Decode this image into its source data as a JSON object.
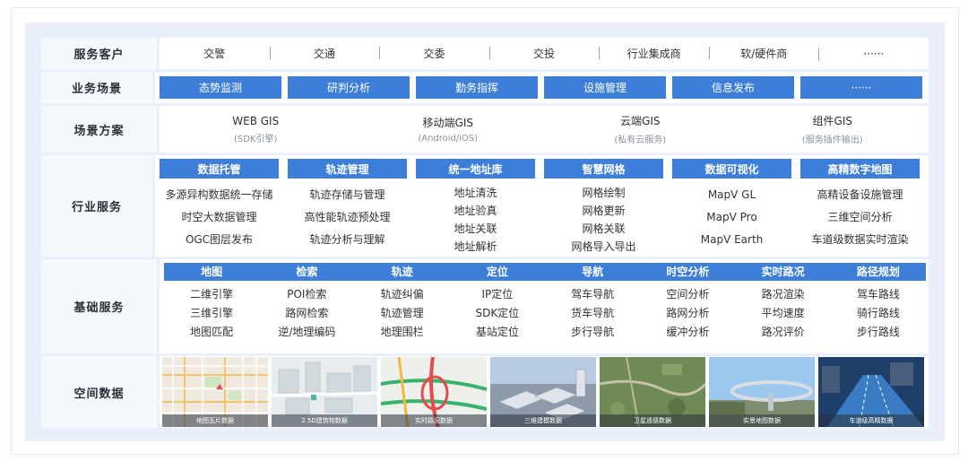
{
  "rows": {
    "customers": {
      "label": "服务客户",
      "items": [
        "交警",
        "交通",
        "交委",
        "交投",
        "行业集成商",
        "软/硬件商",
        "······"
      ]
    },
    "scenarios": {
      "label": "业务场景",
      "items": [
        "态势监测",
        "研判分析",
        "勤务指挥",
        "设施管理",
        "信息发布",
        "······"
      ]
    },
    "solutions": {
      "label": "场景方案",
      "items": [
        {
          "title": "WEB GIS",
          "sub": "(SDK引擎)"
        },
        {
          "title": "移动端GIS",
          "sub": "(Android/iOS)"
        },
        {
          "title": "云端GIS",
          "sub": "(私有云服务)"
        },
        {
          "title": "组件GIS",
          "sub": "(服务插件输出)"
        }
      ]
    },
    "industry": {
      "label": "行业服务",
      "groups": [
        {
          "head": "数据托管",
          "items": [
            "多源异构数据统一存储",
            "时空大数据管理",
            "OGC图层发布"
          ]
        },
        {
          "head": "轨迹管理",
          "items": [
            "轨迹存储与管理",
            "高性能轨迹预处理",
            "轨迹分析与理解"
          ]
        },
        {
          "head": "统一地址库",
          "items": [
            "地址清洗",
            "地址验真",
            "地址关联",
            "地址解析"
          ]
        },
        {
          "head": "智慧网格",
          "items": [
            "网格绘制",
            "网格更新",
            "网格关联",
            "网格导入导出"
          ]
        },
        {
          "head": "数据可视化",
          "items": [
            "MapV GL",
            "MapV Pro",
            "MapV Earth"
          ]
        },
        {
          "head": "高精数字地图",
          "items": [
            "高精设备设施管理",
            "三维空间分析",
            "车道级数据实时渲染"
          ]
        }
      ]
    },
    "base": {
      "label": "基础服务",
      "heads": [
        "地图",
        "检索",
        "轨迹",
        "定位",
        "导航",
        "时空分析",
        "实时路况",
        "路径规划"
      ],
      "columns": [
        [
          "二维引擎",
          "三维引擎",
          "地图匹配"
        ],
        [
          "POI检索",
          "路网检索",
          "逆/地理编码"
        ],
        [
          "轨迹纠偏",
          "轨迹管理",
          "地理围栏"
        ],
        [
          "IP定位",
          "SDK定位",
          "基站定位"
        ],
        [
          "驾车导航",
          "货车导航",
          "步行导航"
        ],
        [
          "空间分析",
          "路网分析",
          "缓冲分析"
        ],
        [
          "路况渲染",
          "平均速度",
          "路况评价"
        ],
        [
          "驾车路线",
          "骑行路线",
          "步行路线"
        ]
      ]
    },
    "spatial": {
      "label": "空间数据",
      "tiles": [
        {
          "caption": "地图瓦片数据",
          "kind": "map"
        },
        {
          "caption": "2.5D建筑物数据",
          "kind": "building"
        },
        {
          "caption": "实时路况数据",
          "kind": "traffic"
        },
        {
          "caption": "三维建模数据",
          "kind": "model3d"
        },
        {
          "caption": "卫星遥感数据",
          "kind": "satellite"
        },
        {
          "caption": "实景地图数据",
          "kind": "street"
        },
        {
          "caption": "车道级高精数据",
          "kind": "hdmap"
        }
      ]
    }
  },
  "colors": {
    "accent": "#3d7fd8",
    "panel_bg": "#e9f0fb",
    "label_bg": "#f5f8fd"
  }
}
